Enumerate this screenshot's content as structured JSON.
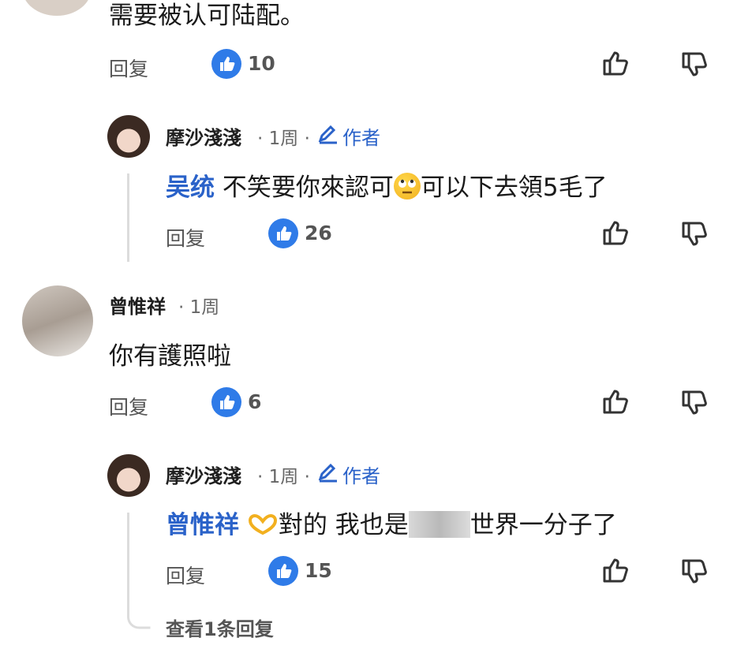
{
  "top_comment": {
    "text": "需要被认可陆配。",
    "reply_label": "回复",
    "likes": "10"
  },
  "reply1": {
    "author": "摩沙淺淺",
    "time": "· 1周 ·",
    "badge": "作者",
    "mention": "吴统",
    "text_before": " 不笑要你來認可",
    "text_after": "可以下去領5毛了",
    "reply_label": "回复",
    "likes": "26"
  },
  "comment2": {
    "author": "曾惟祥",
    "time": "· 1周",
    "text": "你有護照啦",
    "reply_label": "回复",
    "likes": "6"
  },
  "reply2": {
    "author": "摩沙淺淺",
    "time": "· 1周 ·",
    "badge": "作者",
    "mention": "曾惟祥",
    "text_before": "對的 我也是",
    "text_after": "世界一分子了",
    "reply_label": "回复",
    "likes": "15"
  },
  "view_more": "查看1条回复",
  "icons": {
    "like": "thumbs-up-outline-icon",
    "dislike": "thumbs-down-outline-icon",
    "like_badge": "like-badge-icon",
    "author_badge": "pencil-icon",
    "emoji1": "eye-roll-emoji",
    "emoji2": "heart-hands-emoji"
  },
  "colors": {
    "link": "#2a62c9",
    "like_badge": "#2f7be8"
  }
}
